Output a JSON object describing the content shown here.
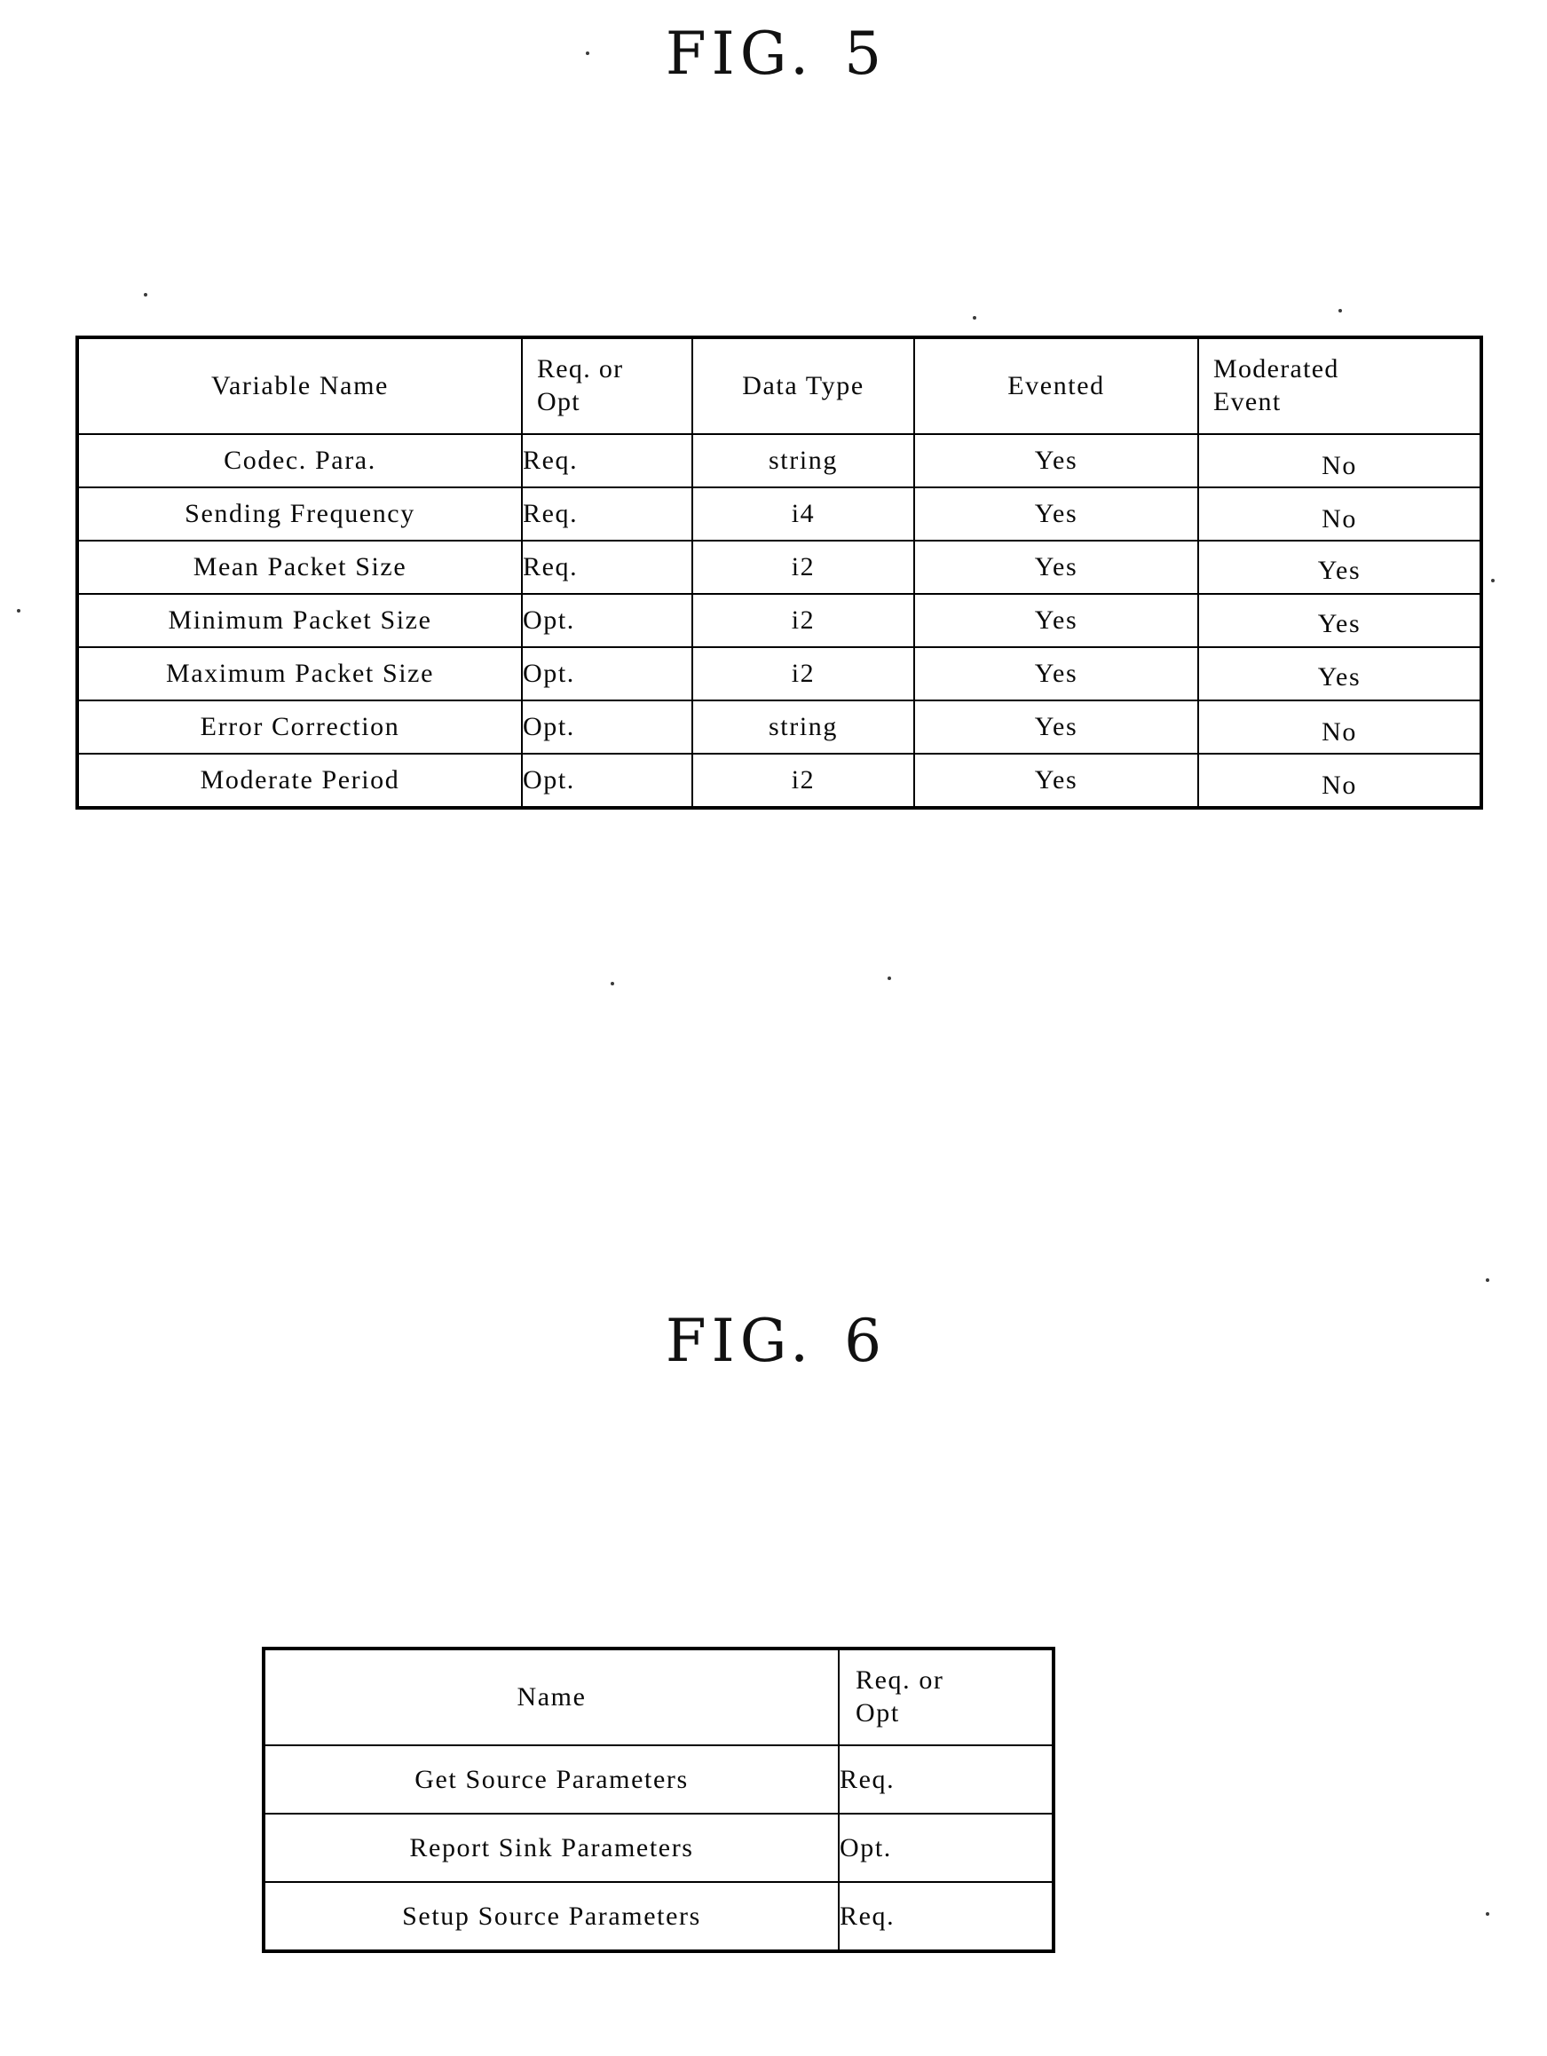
{
  "figures": [
    {
      "label": "FIG.",
      "number": "5",
      "table": {
        "headers": [
          "Variable Name",
          [
            "Req. or",
            "Opt"
          ],
          "Data Type",
          "Evented",
          [
            "Moderated",
            "Event"
          ]
        ],
        "rows": [
          {
            "variable_name": "Codec. Para.",
            "req_or_opt": "Req.",
            "data_type": "string",
            "evented": "Yes",
            "moderated_event": "No"
          },
          {
            "variable_name": "Sending Frequency",
            "req_or_opt": "Req.",
            "data_type": "i4",
            "evented": "Yes",
            "moderated_event": "No"
          },
          {
            "variable_name": "Mean Packet Size",
            "req_or_opt": "Req.",
            "data_type": "i2",
            "evented": "Yes",
            "moderated_event": "Yes"
          },
          {
            "variable_name": "Minimum Packet Size",
            "req_or_opt": "Opt.",
            "data_type": "i2",
            "evented": "Yes",
            "moderated_event": "Yes"
          },
          {
            "variable_name": "Maximum Packet Size",
            "req_or_opt": "Opt.",
            "data_type": "i2",
            "evented": "Yes",
            "moderated_event": "Yes"
          },
          {
            "variable_name": "Error Correction",
            "req_or_opt": "Opt.",
            "data_type": "string",
            "evented": "Yes",
            "moderated_event": "No"
          },
          {
            "variable_name": "Moderate Period",
            "req_or_opt": "Opt.",
            "data_type": "i2",
            "evented": "Yes",
            "moderated_event": "No"
          }
        ]
      }
    },
    {
      "label": "FIG.",
      "number": "6",
      "table": {
        "headers": [
          "Name",
          [
            "Req. or",
            "Opt"
          ]
        ],
        "rows": [
          {
            "name": "Get Source Parameters",
            "req_or_opt": "Req."
          },
          {
            "name": "Report Sink Parameters",
            "req_or_opt": "Opt."
          },
          {
            "name": "Setup Source Parameters",
            "req_or_opt": "Req."
          }
        ]
      }
    }
  ],
  "colors": {
    "ink": "#000000",
    "page": "#ffffff"
  }
}
